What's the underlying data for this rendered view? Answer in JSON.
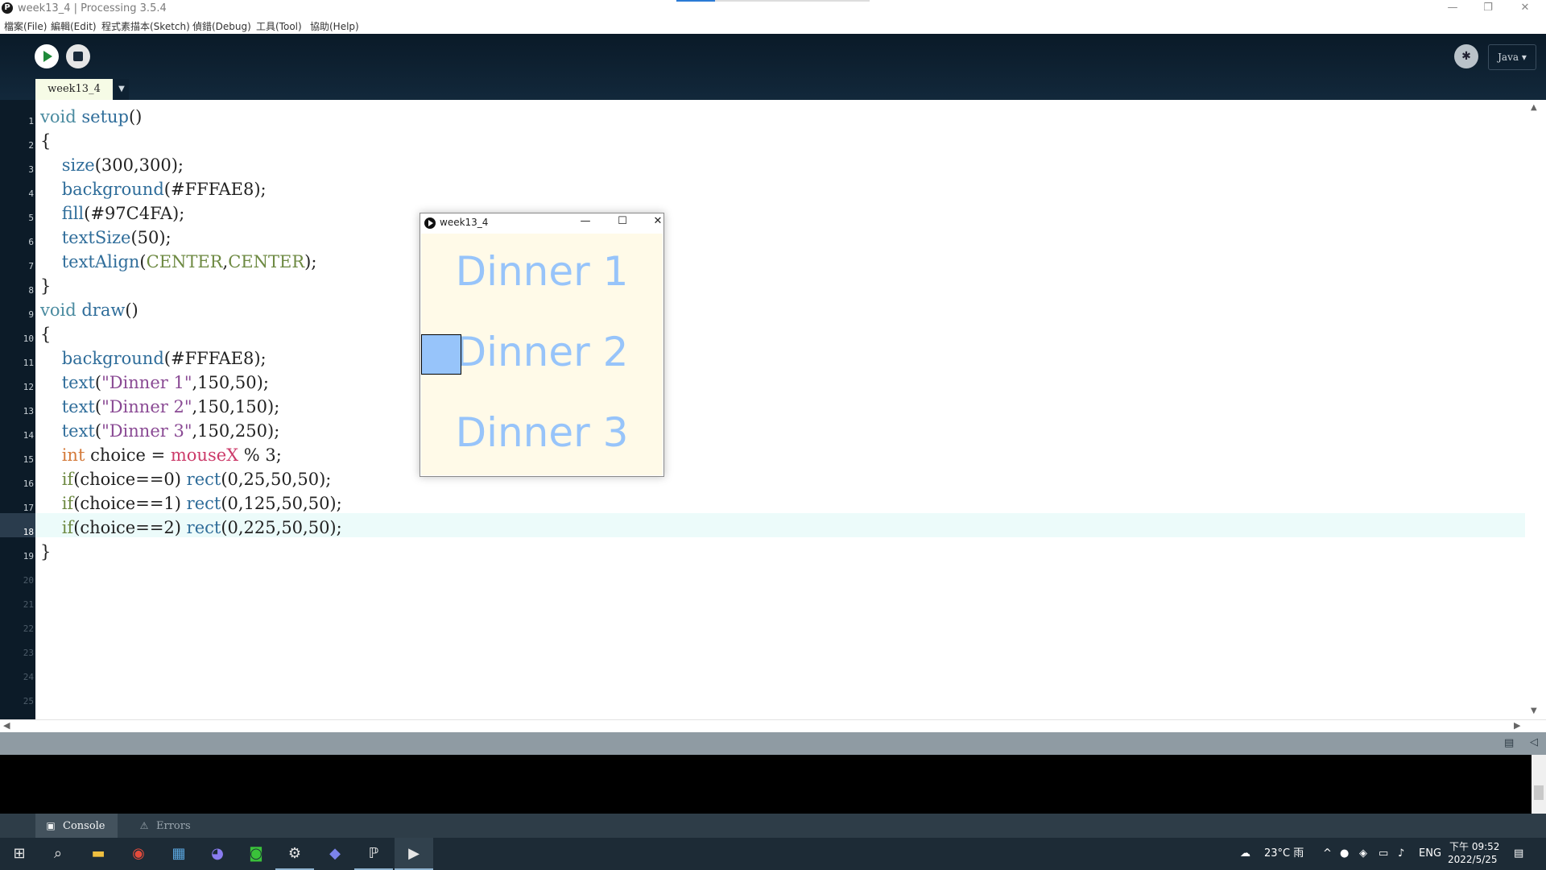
{
  "window": {
    "title": "week13_4 | Processing 3.5.4"
  },
  "menu": [
    "檔案(File)",
    "編輯(Edit)",
    "程式素描本(Sketch)",
    "偵錯(Debug)",
    "工具(Tool)",
    "協助(Help)"
  ],
  "toolbar": {
    "mode": "Java ▾"
  },
  "tab": {
    "name": "week13_4"
  },
  "line_numbers": [
    "1",
    "2",
    "3",
    "4",
    "5",
    "6",
    "7",
    "8",
    "9",
    "10",
    "11",
    "12",
    "13",
    "14",
    "15",
    "16",
    "17",
    "18",
    "19",
    "20",
    "21",
    "22",
    "23",
    "24",
    "25"
  ],
  "current_line": 18,
  "code": [
    [
      {
        "t": "void",
        "c": "kw"
      },
      {
        "t": " "
      },
      {
        "t": "setup",
        "c": "fn"
      },
      {
        "t": "()"
      }
    ],
    [
      {
        "t": "{"
      }
    ],
    [
      {
        "t": "    "
      },
      {
        "t": "size",
        "c": "fn"
      },
      {
        "t": "(300,300);"
      }
    ],
    [
      {
        "t": "    "
      },
      {
        "t": "background",
        "c": "fn"
      },
      {
        "t": "(#FFFAE8);"
      }
    ],
    [
      {
        "t": "    "
      },
      {
        "t": "fill",
        "c": "fn"
      },
      {
        "t": "(#97C4FA);"
      }
    ],
    [
      {
        "t": "    "
      },
      {
        "t": "textSize",
        "c": "fn"
      },
      {
        "t": "(50);"
      }
    ],
    [
      {
        "t": "    "
      },
      {
        "t": "textAlign",
        "c": "fn"
      },
      {
        "t": "("
      },
      {
        "t": "CENTER",
        "c": "cst"
      },
      {
        "t": ","
      },
      {
        "t": "CENTER",
        "c": "cst"
      },
      {
        "t": ");"
      }
    ],
    [
      {
        "t": "}"
      }
    ],
    [
      {
        "t": "void",
        "c": "kw"
      },
      {
        "t": " "
      },
      {
        "t": "draw",
        "c": "fn"
      },
      {
        "t": "()"
      }
    ],
    [
      {
        "t": "{"
      }
    ],
    [
      {
        "t": "    "
      },
      {
        "t": "background",
        "c": "fn"
      },
      {
        "t": "(#FFFAE8);"
      }
    ],
    [
      {
        "t": "    "
      },
      {
        "t": "text",
        "c": "fn"
      },
      {
        "t": "("
      },
      {
        "t": "\"Dinner 1\"",
        "c": "st"
      },
      {
        "t": ",150,50);"
      }
    ],
    [
      {
        "t": "    "
      },
      {
        "t": "text",
        "c": "fn"
      },
      {
        "t": "("
      },
      {
        "t": "\"Dinner 2\"",
        "c": "st"
      },
      {
        "t": ",150,150);"
      }
    ],
    [
      {
        "t": "    "
      },
      {
        "t": "text",
        "c": "fn"
      },
      {
        "t": "("
      },
      {
        "t": "\"Dinner 3\"",
        "c": "st"
      },
      {
        "t": ",150,250);"
      }
    ],
    [
      {
        "t": "    "
      },
      {
        "t": "int",
        "c": "ty"
      },
      {
        "t": " choice = "
      },
      {
        "t": "mouseX",
        "c": "pk"
      },
      {
        "t": " % 3;"
      }
    ],
    [
      {
        "t": "    "
      },
      {
        "t": "if",
        "c": "cst"
      },
      {
        "t": "(choice==0) "
      },
      {
        "t": "rect",
        "c": "fn"
      },
      {
        "t": "(0,25,50,50);"
      }
    ],
    [
      {
        "t": "    "
      },
      {
        "t": "if",
        "c": "cst"
      },
      {
        "t": "(choice==1) "
      },
      {
        "t": "rect",
        "c": "fn"
      },
      {
        "t": "(0,125,50,50);"
      }
    ],
    [
      {
        "t": "    "
      },
      {
        "t": "if",
        "c": "cst"
      },
      {
        "t": "(choice==2) "
      },
      {
        "t": "rect",
        "c": "fn"
      },
      {
        "t": "(0,225,50,50);"
      }
    ],
    [
      {
        "t": "}"
      }
    ]
  ],
  "sketch": {
    "title": "week13_4",
    "texts": [
      "Dinner 1",
      "Dinner 2",
      "Dinner 3"
    ],
    "background": "#FFFAE8",
    "fill": "#97C4FA"
  },
  "console_tabs": {
    "console": "Console",
    "errors": "Errors"
  },
  "taskbar": {
    "weather": "23°C 雨",
    "lang": "ENG",
    "time": "下午 09:52",
    "date": "2022/5/25"
  }
}
